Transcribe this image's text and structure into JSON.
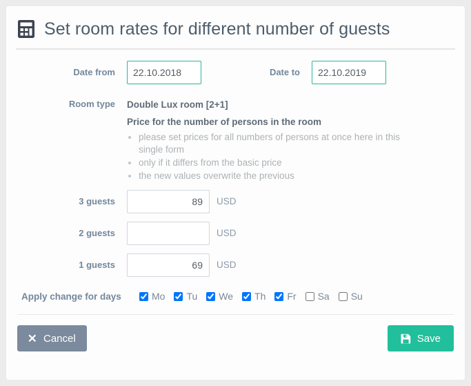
{
  "header": {
    "icon": "calculator-icon",
    "title": "Set room rates for different number of guests"
  },
  "form": {
    "date_from": {
      "label": "Date from",
      "value": "22.10.2018",
      "placeholder": "dd.mm.yyyy"
    },
    "date_to": {
      "label": "Date to",
      "value": "22.10.2019",
      "placeholder": "dd.mm.yyyy"
    },
    "room_type": {
      "label": "Room type",
      "value": "Double Lux room [2+1]"
    },
    "price_section": {
      "heading": "Price for the number of persons in the room",
      "hints": [
        "please set prices for all numbers of persons at once here in this single form",
        "only if it differs from the basic price",
        "the new values overwrite the previous"
      ]
    },
    "guest_prices": [
      {
        "label": "3 guests",
        "value": "89",
        "placeholder": "",
        "currency": "USD"
      },
      {
        "label": "2 guests",
        "value": "",
        "placeholder": "",
        "currency": "USD"
      },
      {
        "label": "1 guests",
        "value": "69",
        "placeholder": "",
        "currency": "USD"
      }
    ],
    "days": {
      "label": "Apply change for days",
      "items": [
        {
          "label": "Mo",
          "checked": true
        },
        {
          "label": "Tu",
          "checked": true
        },
        {
          "label": "We",
          "checked": true
        },
        {
          "label": "Th",
          "checked": true
        },
        {
          "label": "Fr",
          "checked": true
        },
        {
          "label": "Sa",
          "checked": false
        },
        {
          "label": "Su",
          "checked": false
        }
      ]
    }
  },
  "footer": {
    "cancel_label": "Cancel",
    "cancel_icon": "close-x-icon",
    "save_label": "Save",
    "save_icon": "floppy-disk-save-icon"
  },
  "colors": {
    "accent_teal": "#21bf9b",
    "field_border_teal": "#26b99a",
    "cancel_gray": "#7b8a9c",
    "label_gray": "#73879c",
    "hint_gray": "#adb2b5",
    "page_bg": "#ececed",
    "card_bg": "#fdfdfd"
  }
}
